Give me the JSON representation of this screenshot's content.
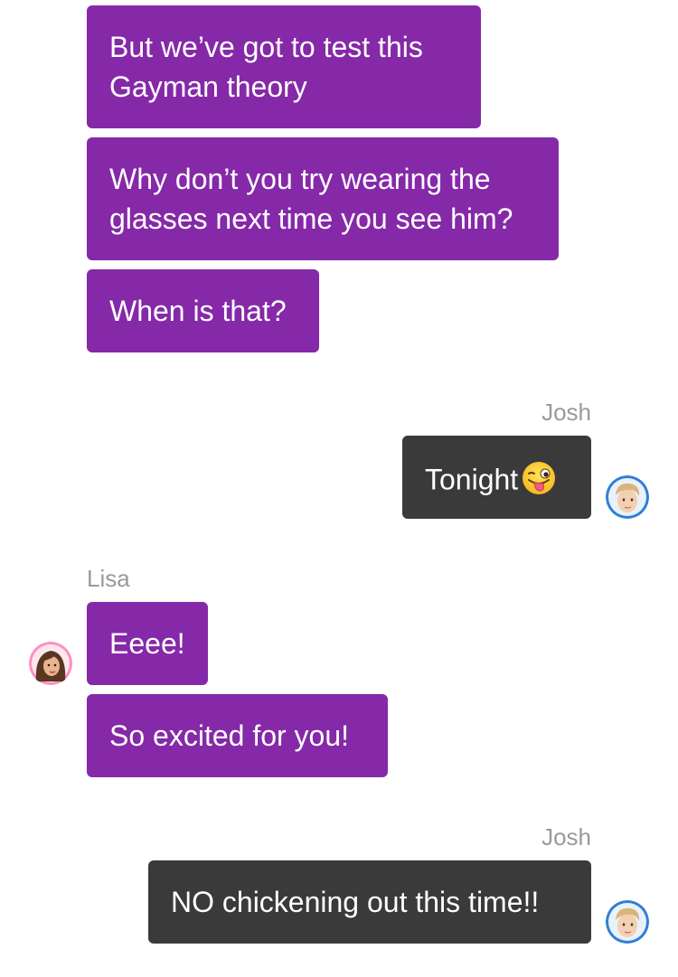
{
  "conversation": {
    "lisa_bubble_1": {
      "line_1": "But we’ve got to test this",
      "line_2": "Gayman theory"
    },
    "lisa_bubble_2": {
      "line_1": "Why don’t you try wearing the",
      "line_2": "glasses next time you see him?"
    },
    "lisa_bubble_3": {
      "text": "When is that?"
    },
    "josh_name_1": "Josh",
    "josh_bubble_1": {
      "text": "Tonight",
      "emoji_icon": "winking-face-with-tongue-icon"
    },
    "lisa_name": "Lisa",
    "lisa_bubble_4": {
      "text": "Eeee!"
    },
    "lisa_bubble_5": {
      "text": "So excited for you!"
    },
    "josh_name_2": "Josh",
    "josh_bubble_2": {
      "text": "NO chickening out this time!!"
    }
  },
  "avatars": {
    "lisa": "lisa-avatar-icon",
    "josh": "josh-avatar-icon"
  },
  "colors": {
    "lisa_bubble": "#8529a8",
    "josh_bubble": "#3a3a3a",
    "sender_name": "#9a9a9a",
    "background": "#ffffff"
  }
}
